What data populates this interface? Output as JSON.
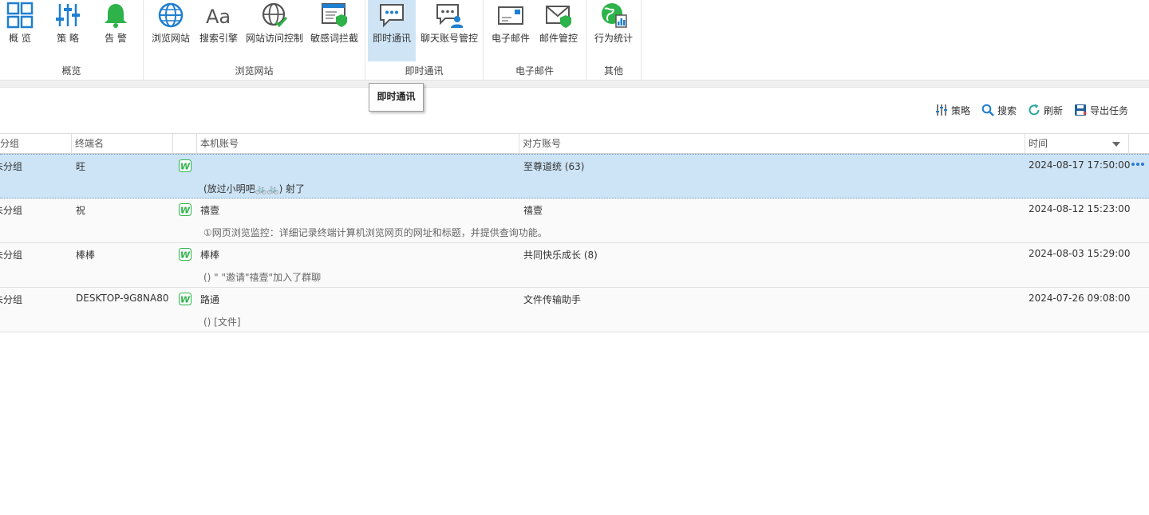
{
  "ribbon": {
    "groups": [
      {
        "label": "概览",
        "buttons": [
          {
            "label": "概 览",
            "icon": "grid-icon"
          },
          {
            "label": "策 略",
            "icon": "sliders-icon"
          },
          {
            "label": "告 警",
            "icon": "bell-icon"
          }
        ]
      },
      {
        "label": "浏览网站",
        "buttons": [
          {
            "label": "浏览网站",
            "icon": "globe-icon"
          },
          {
            "label": "搜索引擎",
            "icon": "font-icon"
          },
          {
            "label": "网站访问控制",
            "icon": "globe-check-icon"
          },
          {
            "label": "敏感词拦截",
            "icon": "browser-shield-icon"
          }
        ]
      },
      {
        "label": "即时通讯",
        "buttons": [
          {
            "label": "即时通讯",
            "icon": "chat-icon",
            "active": true
          },
          {
            "label": "聊天账号管控",
            "icon": "chat-user-icon"
          }
        ]
      },
      {
        "label": "电子邮件",
        "buttons": [
          {
            "label": "电子邮件",
            "icon": "mail-icon"
          },
          {
            "label": "邮件管控",
            "icon": "mail-shield-icon"
          }
        ]
      },
      {
        "label": "其他",
        "buttons": [
          {
            "label": "行为统计",
            "icon": "globe-chart-icon"
          }
        ]
      }
    ]
  },
  "tooltip": "即时通讯",
  "toolbar": {
    "strategy": "策略",
    "search": "搜索",
    "refresh": "刷新",
    "export": "导出任务"
  },
  "table": {
    "headers": {
      "group": "分组",
      "terminal": "终端名",
      "local": "本机账号",
      "peer": "对方账号",
      "time": "时间"
    },
    "rows": [
      {
        "group": "未分组",
        "terminal": "旺",
        "local": "",
        "peer": "至尊道统 (63)",
        "time": "2024-08-17 17:50:00",
        "message": "(放过小明吧🚲🚲) 射了",
        "selected": true
      },
      {
        "group": "未分组",
        "terminal": "祝",
        "local": "禧壹",
        "peer": "禧壹",
        "time": "2024-08-12 15:23:00",
        "message": "①网页浏览监控：详细记录终端计算机浏览网页的网址和标题，并提供查询功能。"
      },
      {
        "group": "未分组",
        "terminal": "棒棒",
        "local": "棒棒",
        "peer": "共同快乐成长 (8)",
        "time": "2024-08-03 15:29:00",
        "message": "() \"      \"邀请\"禧壹\"加入了群聊"
      },
      {
        "group": "未分组",
        "terminal": "DESKTOP-9G8NA80",
        "local": "路通",
        "peer": "文件传输助手",
        "time": "2024-07-26 09:08:00",
        "message": "() [文件]"
      }
    ]
  },
  "colors": {
    "accent": "#1f7fd0",
    "green": "#2db34a",
    "selected_row": "#cde4f6"
  }
}
